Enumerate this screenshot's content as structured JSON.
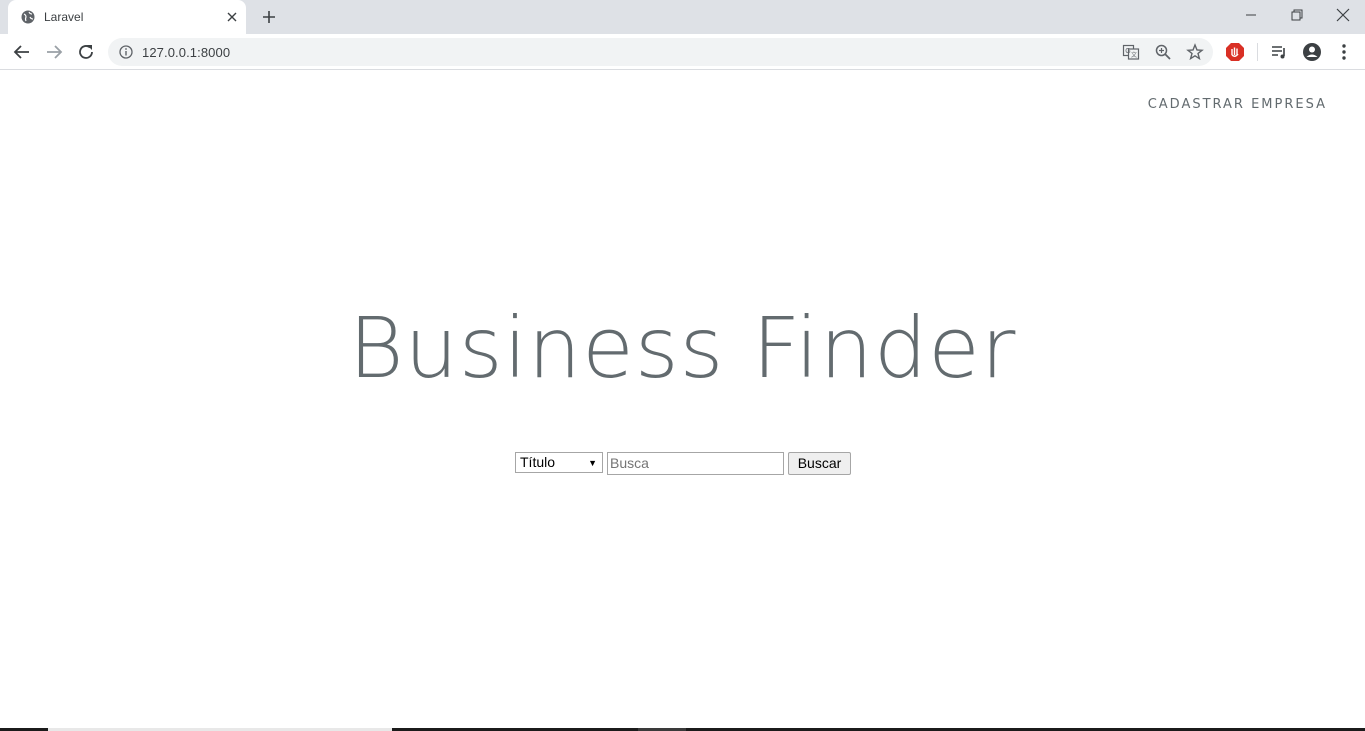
{
  "browser": {
    "tab_title": "Laravel",
    "url": "127.0.0.1:8000"
  },
  "page": {
    "top_link": "CADASTRAR EMPRESA",
    "title": "Business Finder",
    "search": {
      "select_value": "Título",
      "input_placeholder": "Busca",
      "input_value": "",
      "button_label": "Buscar"
    }
  },
  "colors": {
    "text_gray": "#636b6f",
    "tabstrip": "#dee1e6",
    "omnibox": "#f1f3f4",
    "extension_red": "#d93025"
  }
}
